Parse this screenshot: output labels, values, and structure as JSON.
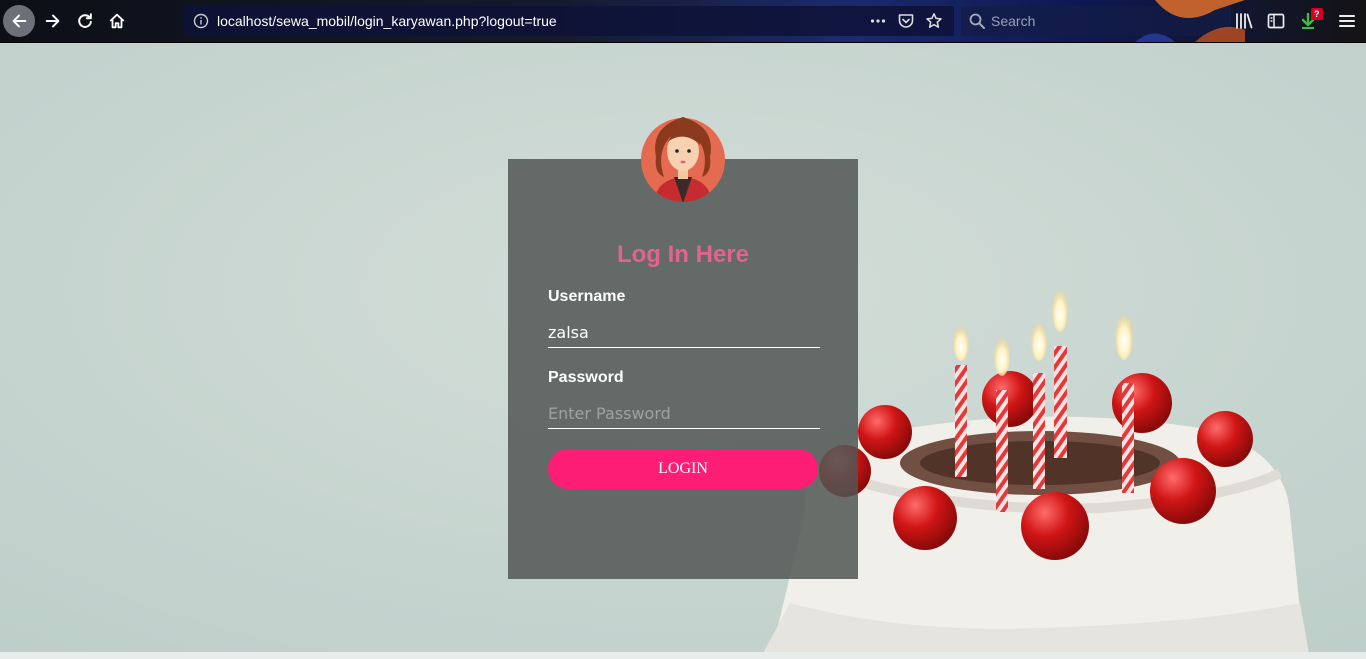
{
  "browser": {
    "url": "localhost/sewa_mobil/login_karyawan.php?logout=true",
    "search_placeholder": "Search",
    "extension_badge": "?"
  },
  "login": {
    "title": "Log In Here",
    "username_label": "Username",
    "username_value": "zalsa",
    "password_label": "Password",
    "password_placeholder": "Enter Password",
    "button_label": "LOGIN"
  },
  "colors": {
    "title": "#e2638e",
    "button": "#fe1d75",
    "panel": "#505654"
  },
  "icons": [
    "back-arrow-icon",
    "forward-arrow-icon",
    "reload-icon",
    "home-icon",
    "info-icon",
    "more-icon",
    "pocket-icon",
    "star-icon",
    "search-icon",
    "library-icon",
    "sidebar-icon",
    "extension-icon",
    "menu-icon",
    "avatar-woman-icon"
  ]
}
